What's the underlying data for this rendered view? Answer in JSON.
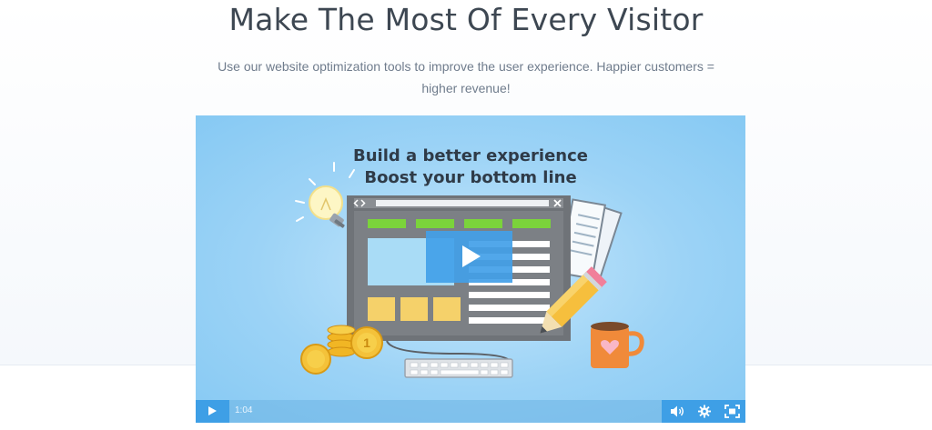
{
  "header": {
    "title": "Make The Most Of Every Visitor",
    "subtitle": "Use our website optimization tools to improve the user experience. Happier customers = higher revenue!"
  },
  "video": {
    "headline_line1": "Build a better experience",
    "headline_line2": "Boost your bottom line",
    "coin_label": "1",
    "current_time": "1:04",
    "icons": {
      "play": "play-icon",
      "volume": "volume-icon",
      "settings": "gear-icon",
      "fullscreen": "fullscreen-icon"
    }
  },
  "colors": {
    "video_bg": "#9cd3f6",
    "control_blue": "#3e9fe6",
    "nav_green": "#7bd33b",
    "monitor_gray": "#6f7378",
    "heading_text": "#3d4752"
  }
}
